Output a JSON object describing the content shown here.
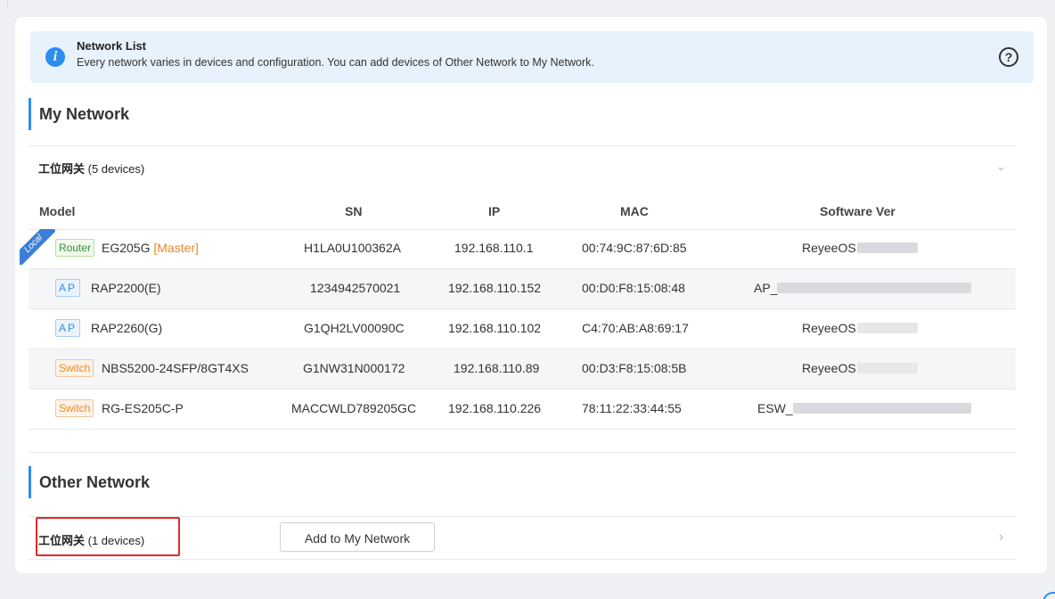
{
  "info": {
    "title": "Network List",
    "description": "Every network varies in devices and configuration. You can add devices of Other Network to My Network."
  },
  "my_network": {
    "title": "My Network",
    "group_name": "工位网关",
    "group_count": "(5 devices)",
    "columns": [
      "Model",
      "SN",
      "IP",
      "MAC",
      "Software Ver"
    ],
    "rows": [
      {
        "type": "Router",
        "model": "EG205G",
        "extra": "[Master]",
        "sn": "H1LA0U100362A",
        "ip": "192.168.110.1",
        "mac": "00:74:9C:87:6D:85",
        "ver": "ReyeeOS",
        "local": "Local"
      },
      {
        "type": "AP",
        "model": "RAP2200(E)",
        "sn": "1234942570021",
        "ip": "192.168.110.152",
        "mac": "00:D0:F8:15:08:48",
        "ver": "AP_"
      },
      {
        "type": "AP",
        "model": "RAP2260(G)",
        "sn": "G1QH2LV00090C",
        "ip": "192.168.110.102",
        "mac": "C4:70:AB:A8:69:17",
        "ver": "ReyeeOS"
      },
      {
        "type": "Switch",
        "model": "NBS5200-24SFP/8GT4XS",
        "sn": "G1NW31N000172",
        "ip": "192.168.110.89",
        "mac": "00:D3:F8:15:08:5B",
        "ver": "ReyeeOS"
      },
      {
        "type": "Switch",
        "model": "RG-ES205C-P",
        "sn": "MACCWLD789205GC",
        "ip": "192.168.110.226",
        "mac": "78:11:22:33:44:55",
        "ver": "ESW_"
      }
    ]
  },
  "other_network": {
    "title": "Other Network",
    "group_name": "工位网关",
    "group_count": "(1 devices)",
    "add_button": "Add to My Network"
  },
  "icons": {
    "info": "info-icon",
    "help": "help-circle-icon",
    "expand": "chevron-down-icon",
    "navigate": "chevron-right-icon"
  },
  "colors": {
    "accent": "#2d8cf0",
    "highlight": "#e02b2b",
    "router_tag": "#3a8f3a",
    "switch_tag": "#e8892a"
  }
}
